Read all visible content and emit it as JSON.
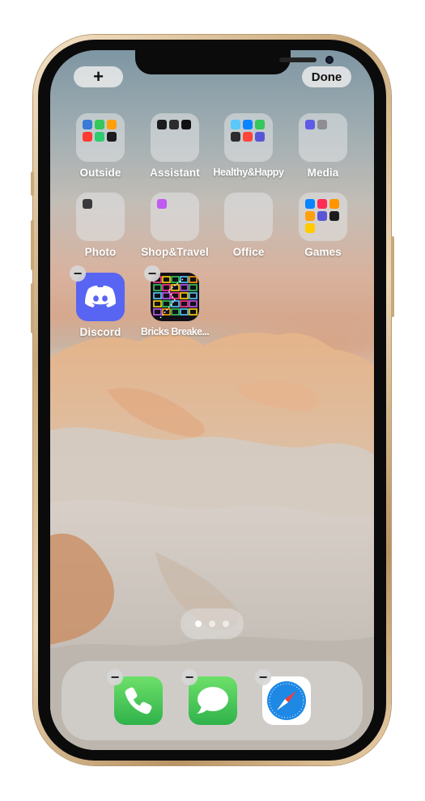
{
  "topbar": {
    "add_label": "+",
    "done_label": "Done"
  },
  "home": {
    "folders": [
      {
        "label": "Outside",
        "colors": [
          "#3a7bd5",
          "#34c759",
          "#ff9f0a",
          "#ff3b30",
          "#2ecc71",
          "#1c1c1e"
        ]
      },
      {
        "label": "Assistant",
        "colors": [
          "#1c1c1e",
          "#2c2c2e",
          "#111111",
          "#ffffff"
        ]
      },
      {
        "label": "Healthy&Happy",
        "colors": [
          "#5ac8fa",
          "#0a84ff",
          "#34c759",
          "#2c2c2e",
          "#ff453a",
          "#5856d6"
        ]
      },
      {
        "label": "Media",
        "colors": [
          "#5e5ce6",
          "#8e8e93"
        ]
      },
      {
        "label": "Photo",
        "colors": [
          "#3a3a3c"
        ]
      },
      {
        "label": "Shop&Travel",
        "colors": [
          "#bf5af2"
        ]
      },
      {
        "label": "Office",
        "colors": []
      },
      {
        "label": "Games",
        "colors": [
          "#0a84ff",
          "#ff2d55",
          "#ff9500",
          "#ff9f0a",
          "#5856d6",
          "#1c1c1e",
          "#ffcc00"
        ]
      }
    ],
    "apps": [
      {
        "label": "Discord",
        "color": "#5865f2"
      },
      {
        "label": "Bricks Breake...",
        "color": "#101018"
      }
    ]
  },
  "page_indicator": {
    "count": 3,
    "active": 0
  },
  "dock": {
    "apps": [
      {
        "name": "Phone",
        "color": "#34c759"
      },
      {
        "name": "Messages",
        "color": "#34c759"
      },
      {
        "name": "Safari",
        "color": "#ffffff"
      }
    ]
  }
}
